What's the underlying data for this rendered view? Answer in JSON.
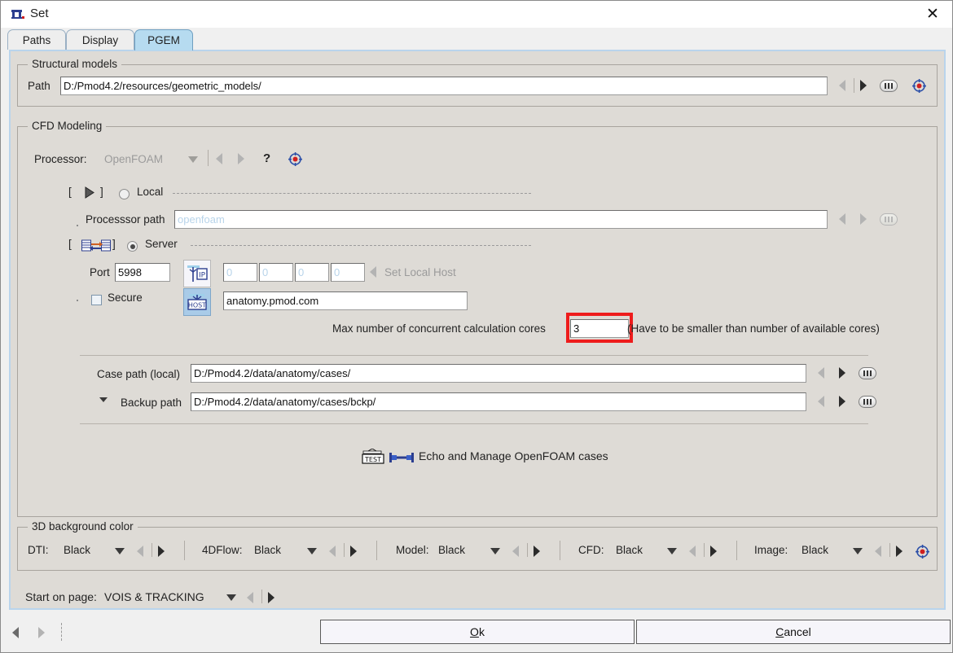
{
  "window": {
    "title": "Set",
    "icon": "pmod-logo-icon",
    "close_label": "✕"
  },
  "tabs": [
    {
      "label": "Paths",
      "active": false
    },
    {
      "label": "Display",
      "active": false
    },
    {
      "label": "PGEM",
      "active": true
    }
  ],
  "structural_models": {
    "group_title": "Structural models",
    "path_label": "Path",
    "path_value": "D:/Pmod4.2/resources/geometric_models/"
  },
  "cfd_modeling": {
    "group_title": "CFD Modeling",
    "processor_label": "Processor:",
    "processor_value": "OpenFOAM",
    "help_label": "?",
    "local": {
      "radio_label": "Local",
      "selected": false,
      "bracket_open": "[",
      "bracket_close": "]",
      "processor_path_label": "Processsor path",
      "processor_path_placeholder": "openfoam",
      "processor_path_value": ""
    },
    "server": {
      "radio_label": "Server",
      "selected": true,
      "bracket_open": "[",
      "bracket_close": "]",
      "port_label": "Port",
      "port_value": "5998",
      "ip_icon_label": "IP",
      "ip_octets": [
        "0",
        "0",
        "0",
        "0"
      ],
      "ip_separator": ".",
      "set_local_host_label": "Set Local Host",
      "secure_label": "Secure",
      "secure_checked": false,
      "host_icon_label": "HOST",
      "host_value": "anatomy.pmod.com"
    },
    "cores": {
      "label": "Max number of concurrent calculation cores",
      "value": "3",
      "hint": "(Have to be smaller than number of available cores)",
      "highlight_color": "#ee1c1c"
    },
    "case_path": {
      "label": "Case path (local)",
      "value": "D:/Pmod4.2/data/anatomy/cases/"
    },
    "backup_path": {
      "label": "Backup path",
      "value": "D:/Pmod4.2/data/anatomy/cases/bckp/"
    },
    "echo_row": {
      "test_icon_label": "TEST",
      "label": "Echo and Manage OpenFOAM cases"
    }
  },
  "background_color": {
    "group_title": "3D background color",
    "items": [
      {
        "label": "DTI:",
        "value": "Black"
      },
      {
        "label": "4DFlow:",
        "value": "Black"
      },
      {
        "label": "Model:",
        "value": "Black"
      },
      {
        "label": "CFD:",
        "value": "Black"
      },
      {
        "label": "Image:",
        "value": "Black"
      }
    ]
  },
  "start_on_page": {
    "label": "Start on page:",
    "value": "VOIS & TRACKING"
  },
  "footer": {
    "ok_label": "Ok",
    "ok_mnemonic": "O",
    "ok_rest": "k",
    "cancel_mnemonic": "C",
    "cancel_rest": "ancel"
  }
}
